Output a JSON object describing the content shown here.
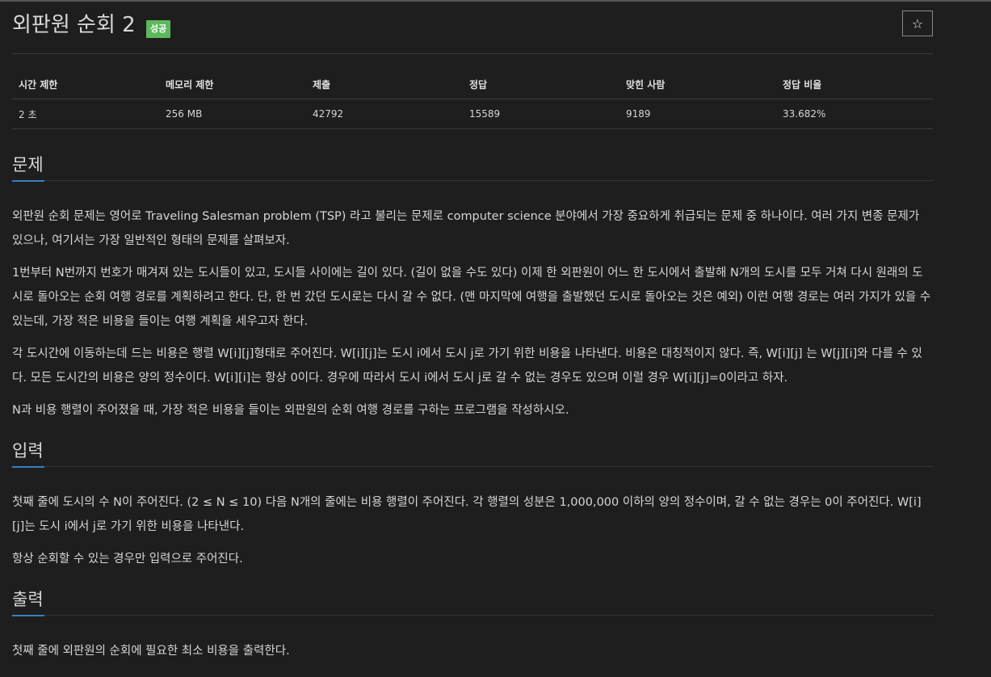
{
  "problem": {
    "title": "외판원 순회 2",
    "badge": "성공",
    "star_icon": "☆"
  },
  "stats": {
    "headers": [
      "시간 제한",
      "메모리 제한",
      "제출",
      "정답",
      "맞힌 사람",
      "정답 비율"
    ],
    "values": [
      "2 초",
      "256 MB",
      "42792",
      "15589",
      "9189",
      "33.682%"
    ]
  },
  "sections": {
    "description": {
      "heading": "문제",
      "paragraphs": [
        "외판원 순회 문제는 영어로 Traveling Salesman problem (TSP) 라고 불리는 문제로 computer science 분야에서 가장 중요하게 취급되는 문제 중 하나이다. 여러 가지 변종 문제가 있으나, 여기서는 가장 일반적인 형태의 문제를 살펴보자.",
        "1번부터 N번까지 번호가 매겨져 있는 도시들이 있고, 도시들 사이에는 길이 있다. (길이 없을 수도 있다) 이제 한 외판원이 어느 한 도시에서 출발해 N개의 도시를 모두 거쳐 다시 원래의 도시로 돌아오는 순회 여행 경로를 계획하려고 한다. 단, 한 번 갔던 도시로는 다시 갈 수 없다. (맨 마지막에 여행을 출발했던 도시로 돌아오는 것은 예외) 이런 여행 경로는 여러 가지가 있을 수 있는데, 가장 적은 비용을 들이는 여행 계획을 세우고자 한다.",
        "각 도시간에 이동하는데 드는 비용은 행렬 W[i][j]형태로 주어진다. W[i][j]는 도시 i에서 도시 j로 가기 위한 비용을 나타낸다. 비용은 대칭적이지 않다. 즉, W[i][j] 는 W[j][i]와 다를 수 있다. 모든 도시간의 비용은 양의 정수이다. W[i][i]는 항상 0이다. 경우에 따라서 도시 i에서 도시 j로 갈 수 없는 경우도 있으며 이럴 경우 W[i][j]=0이라고 하자.",
        "N과 비용 행렬이 주어졌을 때, 가장 적은 비용을 들이는 외판원의 순회 여행 경로를 구하는 프로그램을 작성하시오."
      ]
    },
    "input": {
      "heading": "입력",
      "paragraphs": [
        "첫째 줄에 도시의 수 N이 주어진다. (2 ≤ N ≤ 10) 다음 N개의 줄에는 비용 행렬이 주어진다. 각 행렬의 성분은 1,000,000 이하의 양의 정수이며, 갈 수 없는 경우는 0이 주어진다. W[i][j]는 도시 i에서 j로 가기 위한 비용을 나타낸다.",
        "항상 순회할 수 있는 경우만 입력으로 주어진다."
      ]
    },
    "output": {
      "heading": "출력",
      "paragraphs": [
        "첫째 줄에 외판원의 순회에 필요한 최소 비용을 출력한다."
      ]
    }
  }
}
